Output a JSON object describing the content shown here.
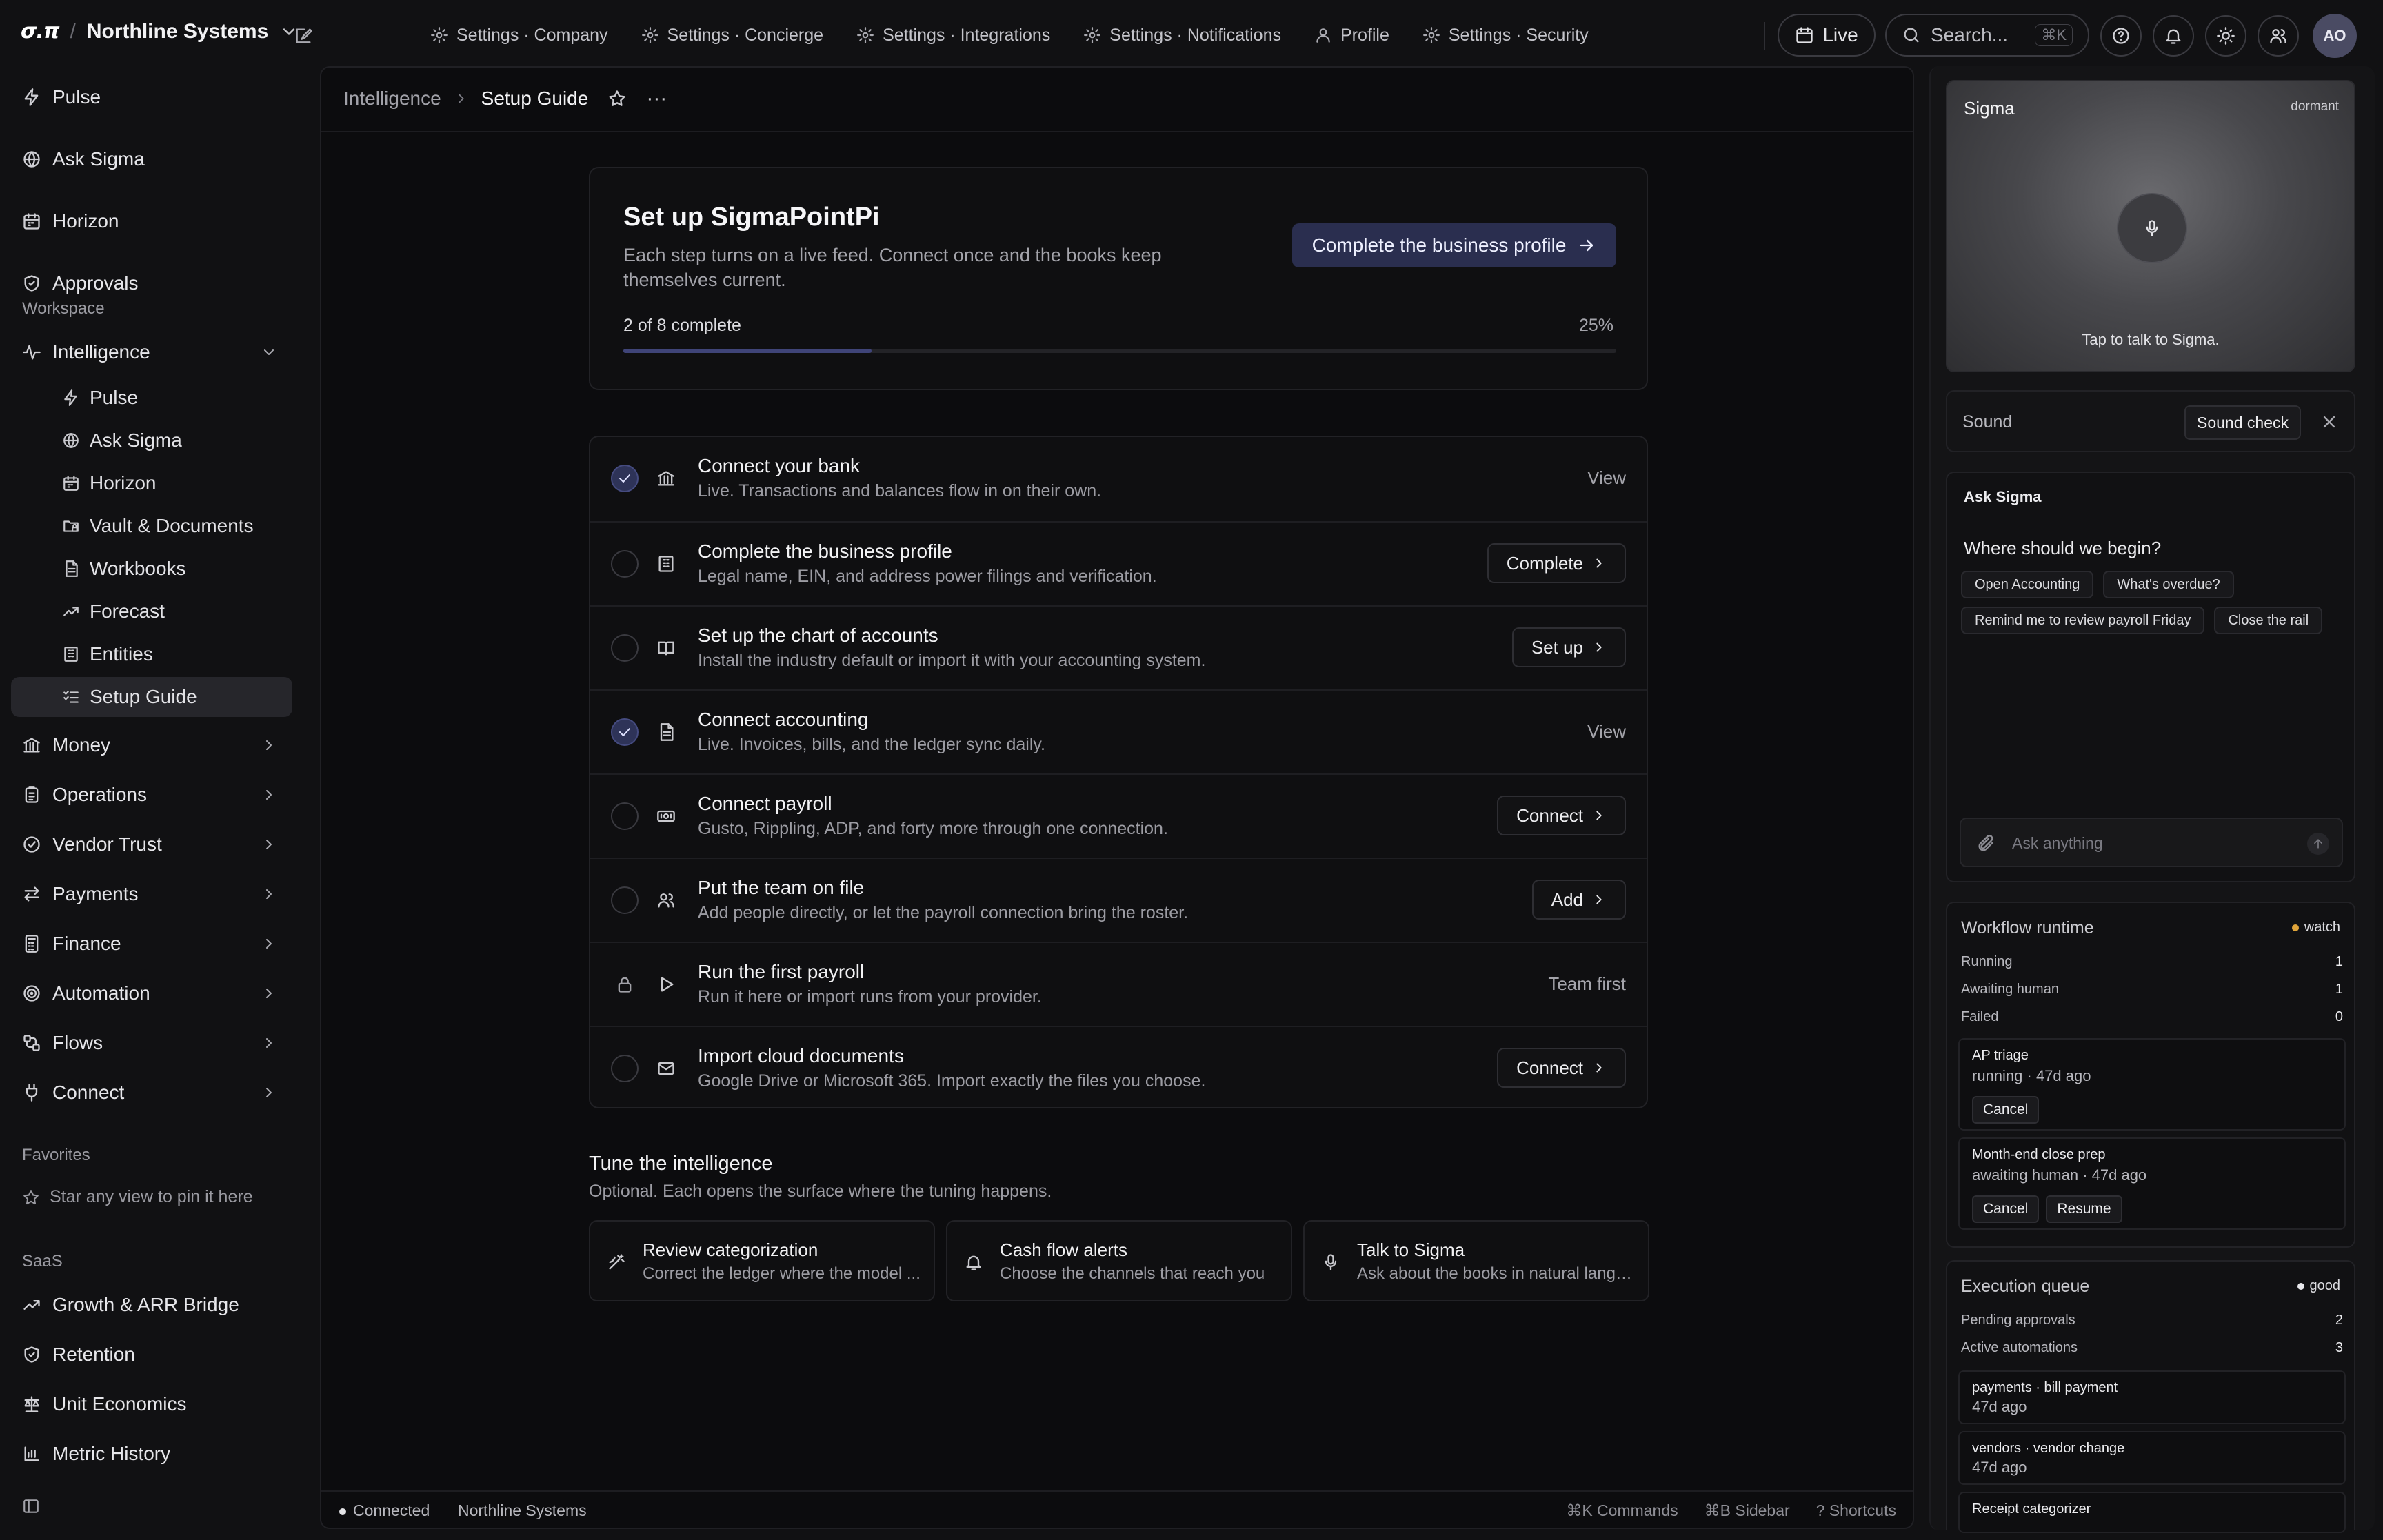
{
  "brand": {
    "logo": "σ.π",
    "separator": "/",
    "org": "Northline Systems"
  },
  "top_tabs": [
    {
      "label": "Settings · Company",
      "icon": "gear-icon"
    },
    {
      "label": "Settings · Concierge",
      "icon": "gear-icon"
    },
    {
      "label": "Settings · Integrations",
      "icon": "gear-icon"
    },
    {
      "label": "Settings · Notifications",
      "icon": "gear-icon"
    },
    {
      "label": "Profile",
      "icon": "user-icon"
    },
    {
      "label": "Settings · Security",
      "icon": "gear-icon"
    }
  ],
  "topbar": {
    "live": "Live",
    "search_placeholder": "Search...",
    "search_shortcut": "⌘K",
    "avatar_initials": "AO"
  },
  "sidebar": {
    "primary": [
      {
        "label": "Pulse",
        "icon": "activity-icon"
      },
      {
        "label": "Ask Sigma",
        "icon": "globe-icon"
      },
      {
        "label": "Horizon",
        "icon": "calendar-icon"
      },
      {
        "label": "Approvals",
        "icon": "shield-icon"
      }
    ],
    "workspace_label": "Workspace",
    "intelligence": {
      "label": "Intelligence",
      "icon": "pulse-line-icon"
    },
    "intelligence_children": [
      {
        "label": "Pulse",
        "icon": "activity-icon"
      },
      {
        "label": "Ask Sigma",
        "icon": "globe-icon"
      },
      {
        "label": "Horizon",
        "icon": "calendar-icon"
      },
      {
        "label": "Vault & Documents",
        "icon": "folder-lock-icon"
      },
      {
        "label": "Workbooks",
        "icon": "file-icon"
      },
      {
        "label": "Forecast",
        "icon": "trend-up-icon"
      },
      {
        "label": "Entities",
        "icon": "building-icon"
      },
      {
        "label": "Setup Guide",
        "icon": "list-check-icon"
      }
    ],
    "groups": [
      {
        "label": "Money",
        "icon": "bank-icon"
      },
      {
        "label": "Operations",
        "icon": "clipboard-icon"
      },
      {
        "label": "Vendor Trust",
        "icon": "check-circle-icon"
      },
      {
        "label": "Payments",
        "icon": "transfer-icon"
      },
      {
        "label": "Finance",
        "icon": "calculator-icon"
      },
      {
        "label": "Automation",
        "icon": "target-icon"
      },
      {
        "label": "Flows",
        "icon": "flow-icon"
      },
      {
        "label": "Connect",
        "icon": "plug-icon"
      }
    ],
    "favorites_label": "Favorites",
    "favorites_hint": "Star any view to pin it here",
    "saas_label": "SaaS",
    "saas": [
      {
        "label": "Growth & ARR Bridge",
        "icon": "trend-up-icon"
      },
      {
        "label": "Retention",
        "icon": "shield-icon"
      },
      {
        "label": "Unit Economics",
        "icon": "scale-icon"
      },
      {
        "label": "Metric History",
        "icon": "bar-chart-icon"
      }
    ]
  },
  "breadcrumb": {
    "root": "Intelligence",
    "current": "Setup Guide"
  },
  "hero": {
    "title": "Set up SigmaPointPi",
    "subtitle": "Each step turns on a live feed. Connect once and the books keep themselves current.",
    "cta": "Complete the business profile",
    "progress_text": "2 of 8 complete",
    "progress_pct_label": "25%",
    "progress_fraction": 0.25
  },
  "steps": [
    {
      "title": "Connect your bank",
      "desc": "Live. Transactions and balances flow in on their own.",
      "state": "done",
      "icon": "bank-icon",
      "action": "View",
      "action_kind": "link"
    },
    {
      "title": "Complete the business profile",
      "desc": "Legal name, EIN, and address power filings and verification.",
      "state": "todo",
      "icon": "building-icon",
      "action": "Complete",
      "action_kind": "button"
    },
    {
      "title": "Set up the chart of accounts",
      "desc": "Install the industry default or import it with your accounting system.",
      "state": "todo",
      "icon": "book-icon",
      "action": "Set up",
      "action_kind": "button"
    },
    {
      "title": "Connect accounting",
      "desc": "Live. Invoices, bills, and the ledger sync daily.",
      "state": "done",
      "icon": "file-icon",
      "action": "View",
      "action_kind": "link"
    },
    {
      "title": "Connect payroll",
      "desc": "Gusto, Rippling, ADP, and forty more through one connection.",
      "state": "todo",
      "icon": "cash-icon",
      "action": "Connect",
      "action_kind": "button"
    },
    {
      "title": "Put the team on file",
      "desc": "Add people directly, or let the payroll connection bring the roster.",
      "state": "todo",
      "icon": "users-icon",
      "action": "Add",
      "action_kind": "button"
    },
    {
      "title": "Run the first payroll",
      "desc": "Run it here or import runs from your provider.",
      "state": "locked",
      "icon": "play-icon",
      "action": "Team first",
      "action_kind": "link"
    },
    {
      "title": "Import cloud documents",
      "desc": "Google Drive or Microsoft 365. Import exactly the files you choose.",
      "state": "todo",
      "icon": "mail-icon",
      "action": "Connect",
      "action_kind": "button"
    }
  ],
  "tune": {
    "title": "Tune the intelligence",
    "subtitle": "Optional. Each opens the surface where the tuning happens.",
    "cards": [
      {
        "title": "Review categorization",
        "desc": "Correct the ledger where the model ...",
        "icon": "wand-icon"
      },
      {
        "title": "Cash flow alerts",
        "desc": "Choose the channels that reach you",
        "icon": "bell-icon"
      },
      {
        "title": "Talk to Sigma",
        "desc": "Ask about the books in natural langu...",
        "icon": "mic-icon"
      }
    ]
  },
  "statusbar": {
    "connection": "Connected",
    "org": "Northline Systems",
    "shortcuts": [
      "⌘K Commands",
      "⌘B Sidebar",
      "? Shortcuts"
    ]
  },
  "voice": {
    "title": "Sigma",
    "state": "dormant",
    "hint": "Tap to talk to Sigma."
  },
  "sound": {
    "label": "Sound",
    "button": "Sound check"
  },
  "ask": {
    "title": "Ask Sigma",
    "question": "Where should we begin?",
    "chips": [
      "Open Accounting",
      "What's overdue?",
      "Remind me to review payroll Friday",
      "Close the rail"
    ],
    "placeholder": "Ask anything"
  },
  "workflow": {
    "title": "Workflow runtime",
    "badge": "watch",
    "badge_color": "#e0a43a",
    "metrics": [
      {
        "label": "Running",
        "value": "1"
      },
      {
        "label": "Awaiting human",
        "value": "1"
      },
      {
        "label": "Failed",
        "value": "0"
      }
    ],
    "runs": [
      {
        "name": "AP triage",
        "meta": "running · 47d ago",
        "buttons": [
          "Cancel"
        ]
      },
      {
        "name": "Month-end close prep",
        "meta": "awaiting human · 47d ago",
        "buttons": [
          "Cancel",
          "Resume"
        ]
      }
    ]
  },
  "queue": {
    "title": "Execution queue",
    "badge": "good",
    "badge_color": "#e8e8ec",
    "metrics": [
      {
        "label": "Pending approvals",
        "value": "2"
      },
      {
        "label": "Active automations",
        "value": "3"
      }
    ],
    "items": [
      {
        "name": "payments · bill payment",
        "meta": "47d ago"
      },
      {
        "name": "vendors · vendor change",
        "meta": "47d ago"
      },
      {
        "name": "Receipt categorizer",
        "meta": ""
      }
    ]
  }
}
